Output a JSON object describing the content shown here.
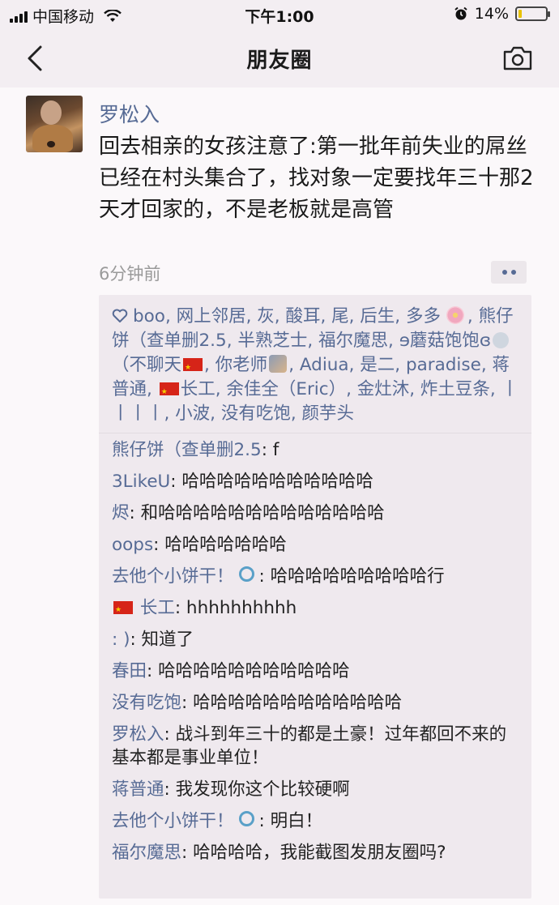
{
  "status_bar": {
    "carrier": "中国移动",
    "time": "下午1:00",
    "battery_percent": "14%",
    "battery_level": 0.14
  },
  "nav": {
    "title": "朋友圈"
  },
  "post": {
    "author": "罗松入",
    "text": "回去相亲的女孩注意了:第一批年前失业的屌丝已经在村头集合了，找对象一定要找年三十那2天才回家的，不是老板就是高管",
    "time": "6分钟前"
  },
  "likes": {
    "part1": "boo, 网上邻居, 灰, 酸耳, 尾, 后生, 多多",
    "part2": ", 熊仔饼（查单删2.5, 半熟芝士, 福尔魔思, ɘ蘑菇饱饱ɞ",
    "part3": "（不聊天",
    "part4": ", 你老师",
    "part5": ", Adiua, 是二, paradise, 蒋普通,",
    "part6": "长工, 余佳全（Eric）, 金灶沐, 炸土豆条, 丨丨丨丨, 小波, 没有吃饱, 颜芋头"
  },
  "comments": [
    {
      "name": "熊仔饼（查单删2.5",
      "text": ": f"
    },
    {
      "name": "3LikeU",
      "text": ": 哈哈哈哈哈哈哈哈哈哈哈"
    },
    {
      "name": "烬",
      "text": ": 和哈哈哈哈哈哈哈哈哈哈哈哈哈"
    },
    {
      "name": "oops",
      "text": ": 哈哈哈哈哈哈哈"
    },
    {
      "name": "去他个小饼干！",
      "text": ": 哈哈哈哈哈哈哈哈哈行"
    },
    {
      "name": "长工",
      "text": ": hhhhhhhhhh"
    },
    {
      "name": ":  )",
      "text": ": 知道了"
    },
    {
      "name": "春田",
      "text": ": 哈哈哈哈哈哈哈哈哈哈哈"
    },
    {
      "name": "没有吃饱",
      "text": ": 哈哈哈哈哈哈哈哈哈哈哈哈"
    },
    {
      "name": "罗松入",
      "text": ": 战斗到年三十的都是土豪！过年都回不来的基本都是事业单位！"
    },
    {
      "name": "蒋普通",
      "text": ": 我发现你这个比较硬啊"
    },
    {
      "name": "去他个小饼干！",
      "text": ": 明白！"
    },
    {
      "name": "福尔魔思",
      "text": ": 哈哈哈哈，我能截图发朋友圈吗?"
    }
  ],
  "colors": {
    "link": "#576b95",
    "background": "#fbf8fa"
  }
}
